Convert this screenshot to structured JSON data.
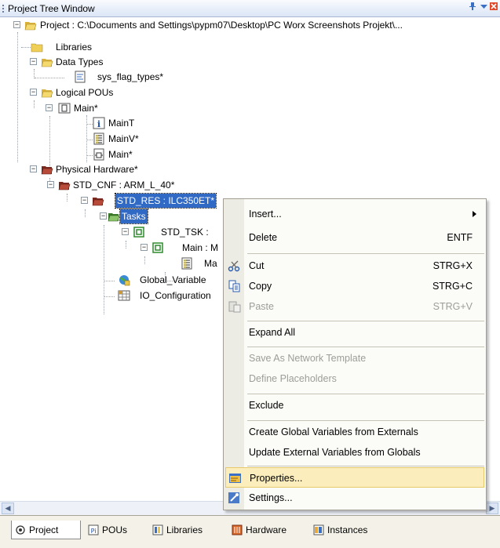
{
  "window": {
    "title": "Project Tree Window",
    "pin_icon": "pin-icon",
    "dropdown_icon": "dropdown-icon",
    "close_icon": "close-icon"
  },
  "tree": {
    "project": "Project : C:\\Documents and Settings\\pypm07\\Desktop\\PC Worx Screenshots Projekt\\...",
    "libraries": "Libraries",
    "data_types": "Data Types",
    "sys_flag_types": "sys_flag_types*",
    "logical_pous": "Logical POUs",
    "main_pou": "Main*",
    "main_t": "MainT",
    "main_v": "MainV*",
    "main_code": "Main*",
    "physical_hardware": "Physical Hardware*",
    "std_cnf": "STD_CNF : ARM_L_40*",
    "std_res": "STD_RES : ILC350ET*",
    "tasks": "Tasks",
    "std_tsk": "STD_TSK :",
    "main_instance": "Main : M",
    "main_leaf": "Ma",
    "global_variables": "Global_Variable",
    "io_configuration": "IO_Configuration"
  },
  "context_menu": {
    "insert": "Insert...",
    "delete": "Delete",
    "delete_shortcut": "ENTF",
    "cut": "Cut",
    "cut_shortcut": "STRG+X",
    "copy": "Copy",
    "copy_shortcut": "STRG+C",
    "paste": "Paste",
    "paste_shortcut": "STRG+V",
    "expand_all": "Expand All",
    "save_as_network_template": "Save As Network Template",
    "define_placeholders": "Define Placeholders",
    "exclude": "Exclude",
    "create_global_variables": "Create Global Variables from Externals",
    "update_external_variables": "Update External Variables from Globals",
    "properties": "Properties...",
    "settings": "Settings..."
  },
  "tabs": {
    "project": "Project",
    "pous": "POUs",
    "libraries": "Libraries",
    "hardware": "Hardware",
    "instances": "Instances"
  },
  "colors": {
    "selection": "#316ac5",
    "menu_hover": "#fbeebc",
    "folder": "#e8c84a"
  }
}
